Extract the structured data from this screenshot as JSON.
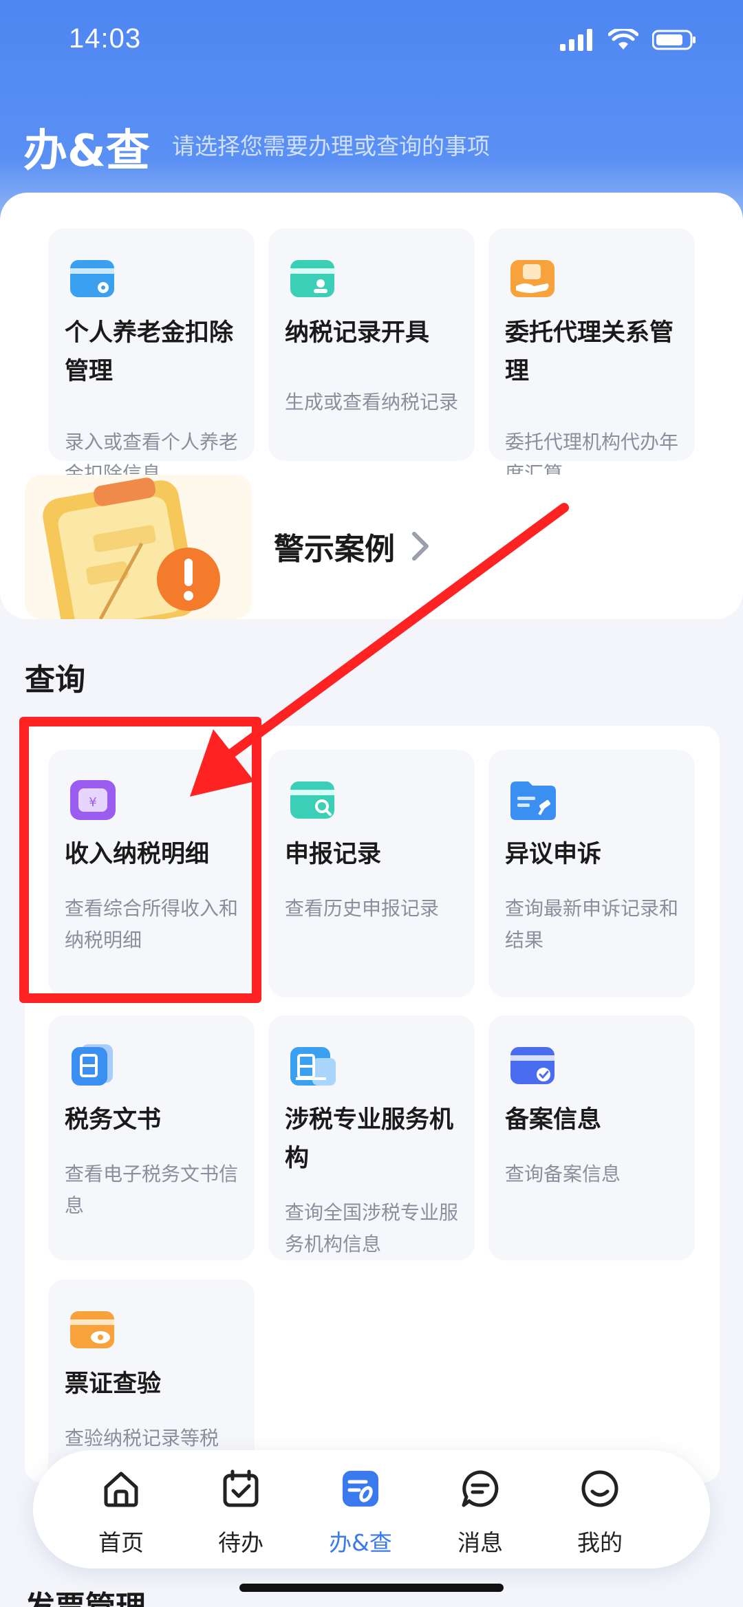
{
  "status_bar": {
    "time": "14:03"
  },
  "header": {
    "title": "办&查",
    "subtitle": "请选择您需要办理或查询的事项"
  },
  "top_cards": [
    {
      "title": "个人养老金扣除管理",
      "desc": "录入或查看个人养老金扣除信息",
      "icon": "card-gear-icon",
      "color": "#3aa0ef"
    },
    {
      "title": "纳税记录开具",
      "desc": "生成或查看纳税记录",
      "icon": "card-user-icon",
      "color": "#3ccfb7"
    },
    {
      "title": "委托代理关系管理",
      "desc": "委托代理机构代办年度汇算",
      "icon": "hand-card-icon",
      "color": "#f7a23a"
    }
  ],
  "warning_banner": {
    "label": "警示案例"
  },
  "query_section": {
    "title": "查询",
    "cards": [
      {
        "title": "收入纳税明细",
        "desc": "查看综合所得收入和纳税明细",
        "icon": "yuan-wallet-icon",
        "color": "#9b5cf0"
      },
      {
        "title": "申报记录",
        "desc": "查看历史申报记录",
        "icon": "card-search-icon",
        "color": "#3ccfb7"
      },
      {
        "title": "异议申诉",
        "desc": "查询最新申诉记录和结果",
        "icon": "folder-hammer-icon",
        "color": "#3a8ff0"
      },
      {
        "title": "税务文书",
        "desc": "查看电子税务文书信息",
        "icon": "document-icon",
        "color": "#3a8ff0"
      },
      {
        "title": "涉税专业服务机构",
        "desc": "查询全国涉税专业服务机构信息",
        "icon": "building-icon",
        "color": "#3aa0ef"
      },
      {
        "title": "备案信息",
        "desc": "查询备案信息",
        "icon": "card-check-icon",
        "color": "#4a6df0"
      },
      {
        "title": "票证查验",
        "desc": "查验纳税记录等税",
        "icon": "card-eye-icon",
        "color": "#f7a23a"
      }
    ]
  },
  "next_section": {
    "title": "发票管理"
  },
  "tabbar": {
    "items": [
      {
        "label": "首页",
        "icon": "home-icon",
        "active": false
      },
      {
        "label": "待办",
        "icon": "calendar-check-icon",
        "active": false
      },
      {
        "label": "办&查",
        "icon": "do-check-icon",
        "active": true
      },
      {
        "label": "消息",
        "icon": "message-icon",
        "active": false
      },
      {
        "label": "我的",
        "icon": "smile-icon",
        "active": false
      }
    ],
    "active_color": "#3a79ee"
  },
  "annotation": {
    "highlight_color": "#ff2222"
  }
}
